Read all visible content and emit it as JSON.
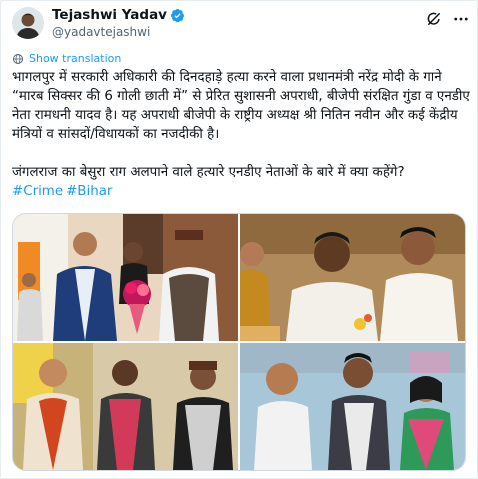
{
  "author": {
    "name": "Tejashwi Yadav",
    "handle": "@yadavtejashwi"
  },
  "translate_label": "Show translation",
  "tweet": {
    "paragraph1": "भागलपुर में सरकारी अधिकारी की दिनदहाड़े हत्या करने वाला प्रधानमंत्री नरेंद्र मोदी के गाने “मारब सिक्सर की 6 गोली छाती में” से प्रेरित सुशासनी अपराधी, बीजेपी संरक्षित गुंडा व एनडीए नेता रामधनी यादव है। यह अपराधी बीजेपी के राष्ट्रीय अध्यक्ष श्री नितिन नवीन और कई केंद्रीय मंत्रियों व सांसदों/विधायकों का नजदीकी है।",
    "paragraph2": "जंगलराज का बेसुरा राग अलपाने वाले हत्यारे एनडीए नेताओं के बारे में क्या कहेंगे?",
    "hashtags": [
      "#Crime",
      "#Bihar"
    ]
  },
  "colors": {
    "accent": "#1d9bf0",
    "text": "#0f1419",
    "secondary": "#536471"
  },
  "icons": [
    "verified-badge-icon",
    "grok-icon",
    "more-options-icon",
    "globe-icon"
  ]
}
